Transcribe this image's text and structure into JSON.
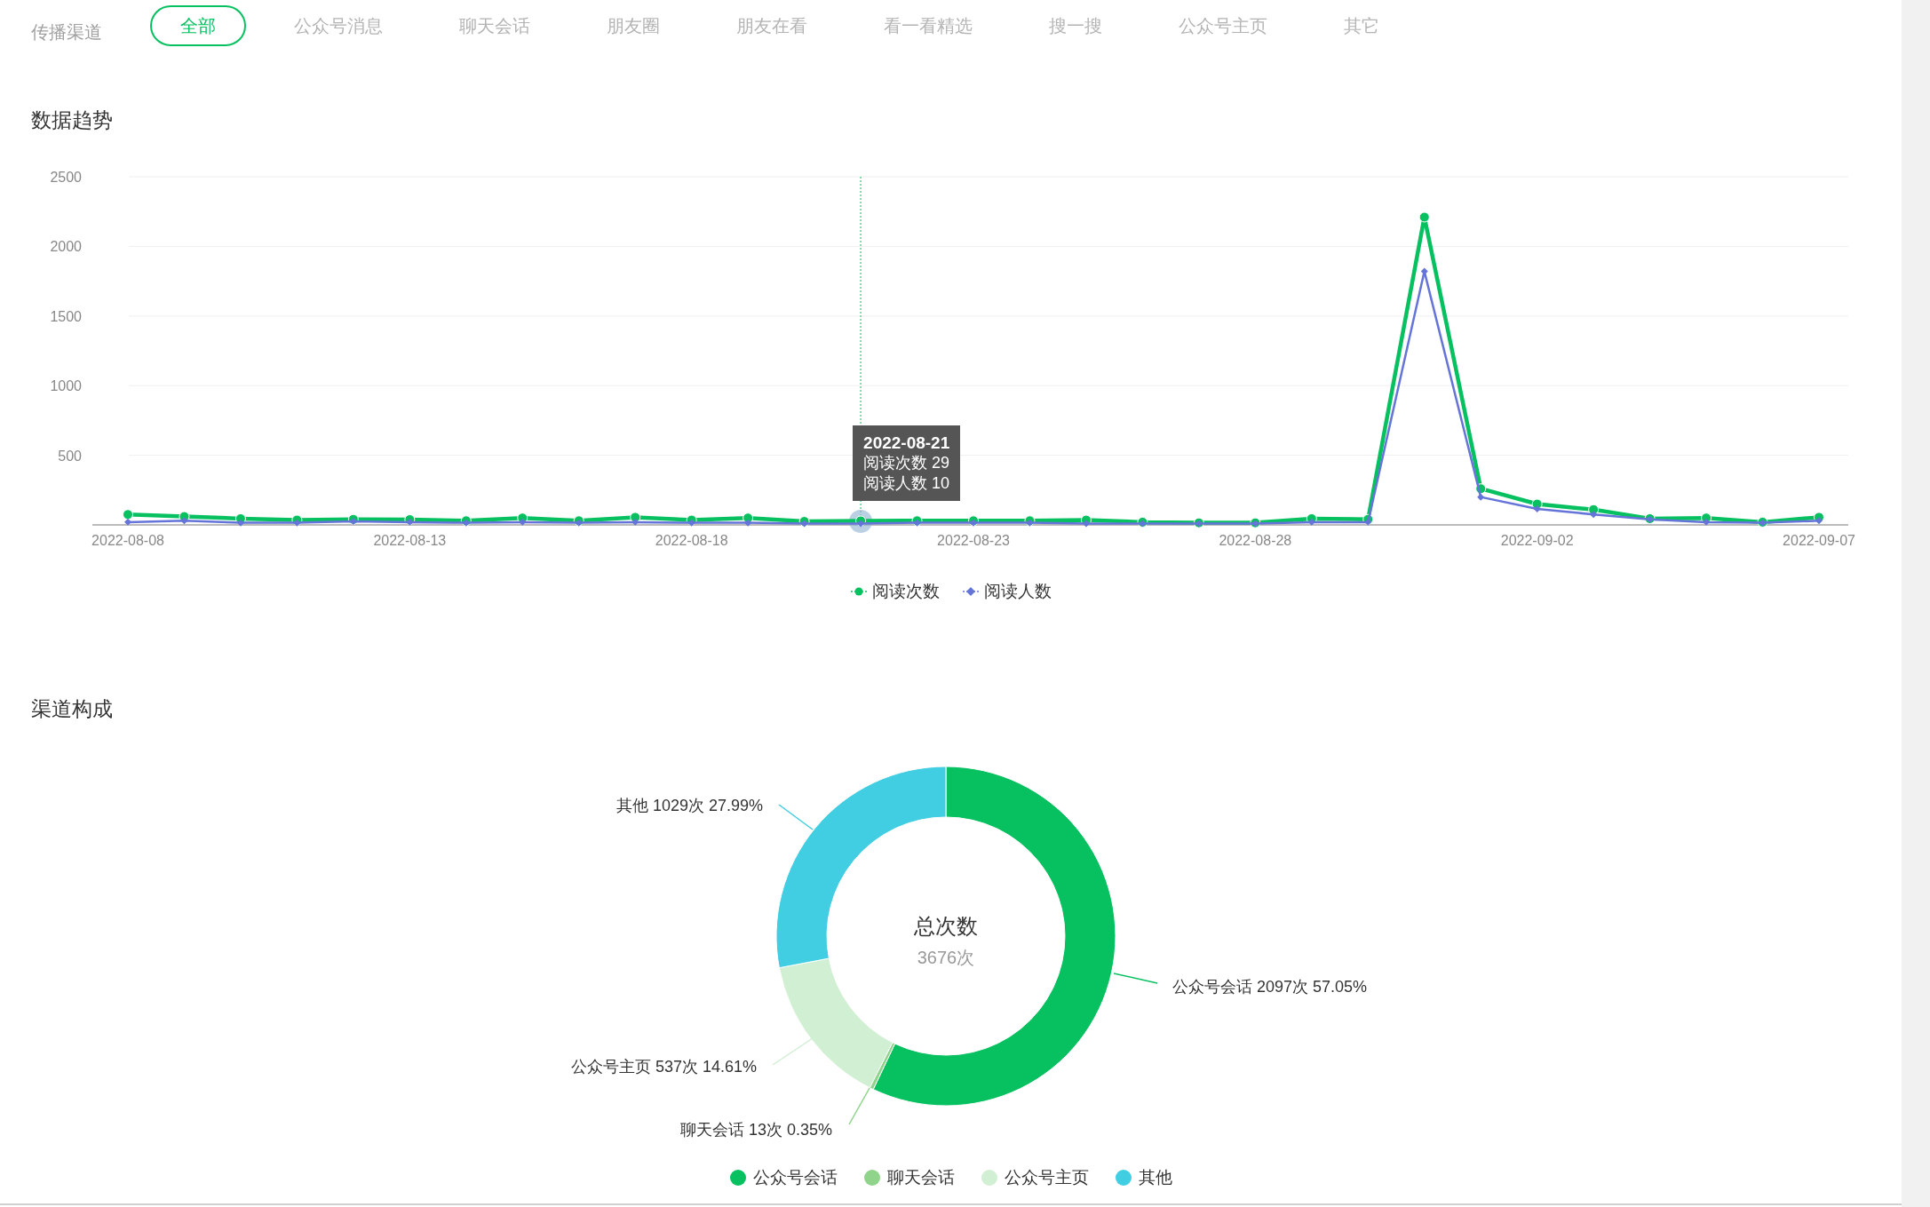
{
  "channel_filter": {
    "label": "传播渠道",
    "tabs": [
      {
        "label": "全部",
        "selected": true
      },
      {
        "label": "公众号消息",
        "selected": false
      },
      {
        "label": "聊天会话",
        "selected": false
      },
      {
        "label": "朋友圈",
        "selected": false
      },
      {
        "label": "朋友在看",
        "selected": false
      },
      {
        "label": "看一看精选",
        "selected": false
      },
      {
        "label": "搜一搜",
        "selected": false
      },
      {
        "label": "公众号主页",
        "selected": false
      },
      {
        "label": "其它",
        "selected": false
      }
    ]
  },
  "trend": {
    "title": "数据趋势",
    "tooltip": {
      "date": "2022-08-21",
      "lines": [
        "阅读次数 29",
        "阅读人数 10"
      ]
    },
    "chart_data": {
      "type": "line",
      "grid": true,
      "categories": [
        "2022-08-08",
        null,
        null,
        null,
        null,
        "2022-08-13",
        null,
        null,
        null,
        null,
        "2022-08-18",
        null,
        null,
        null,
        null,
        "2022-08-23",
        null,
        null,
        null,
        null,
        "2022-08-28",
        null,
        null,
        null,
        null,
        "2022-09-02",
        null,
        null,
        null,
        null,
        "2022-09-07"
      ],
      "series": [
        {
          "name": "阅读次数",
          "color": "#07c160",
          "marker": "circle",
          "values": [
            75,
            60,
            45,
            35,
            40,
            38,
            30,
            50,
            30,
            55,
            35,
            50,
            25,
            29,
            30,
            30,
            30,
            35,
            20,
            15,
            15,
            45,
            40,
            2210,
            260,
            150,
            110,
            45,
            50,
            20,
            55
          ]
        },
        {
          "name": "阅读人数",
          "color": "#6574d8",
          "marker": "diamond",
          "values": [
            20,
            30,
            15,
            15,
            25,
            20,
            15,
            20,
            15,
            20,
            15,
            15,
            10,
            10,
            15,
            15,
            15,
            10,
            10,
            10,
            10,
            20,
            20,
            1820,
            200,
            115,
            75,
            40,
            20,
            15,
            30
          ]
        }
      ],
      "ylim": [
        0,
        2500
      ],
      "yticks": [
        500,
        1000,
        1500,
        2000,
        2500
      ]
    }
  },
  "composition": {
    "title": "渠道构成",
    "center_title": "总次数",
    "center_value": "3676次",
    "chart_data": {
      "type": "donut",
      "categories": [
        "公众号会话",
        "聊天会话",
        "公众号主页",
        "其他"
      ],
      "values": [
        2097,
        13,
        537,
        1029
      ],
      "colors": [
        "#07c160",
        "#8fd48a",
        "#d1efd3",
        "#41cde2"
      ],
      "value_labels": [
        "公众号会话 2097次 57.05%",
        "聊天会话 13次 0.35%",
        "公众号主页 537次 14.61%",
        "其他 1029次 27.99%"
      ]
    }
  }
}
